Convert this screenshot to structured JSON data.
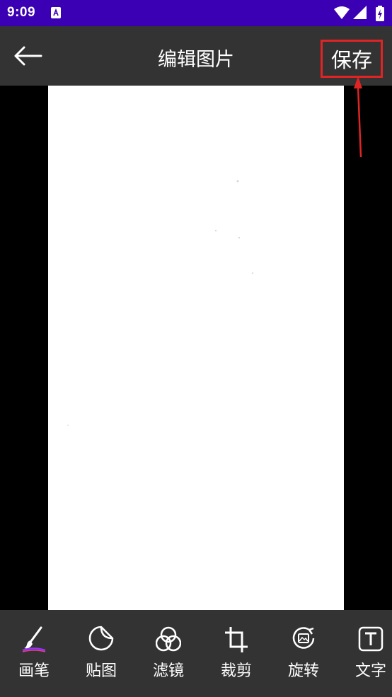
{
  "status_bar": {
    "time": "9:09"
  },
  "app_bar": {
    "title": "编辑图片",
    "save_label": "保存"
  },
  "colors": {
    "status_bar": "#3b00b3",
    "app_bar": "#333333",
    "annotation": "#e02424",
    "toolbar": "#333333"
  },
  "toolbar": {
    "items": [
      {
        "label": "画笔",
        "icon": "brush-icon"
      },
      {
        "label": "贴图",
        "icon": "sticker-icon"
      },
      {
        "label": "滤镜",
        "icon": "filter-icon"
      },
      {
        "label": "裁剪",
        "icon": "crop-icon"
      },
      {
        "label": "旋转",
        "icon": "rotate-icon"
      },
      {
        "label": "文字",
        "icon": "text-icon"
      }
    ]
  }
}
